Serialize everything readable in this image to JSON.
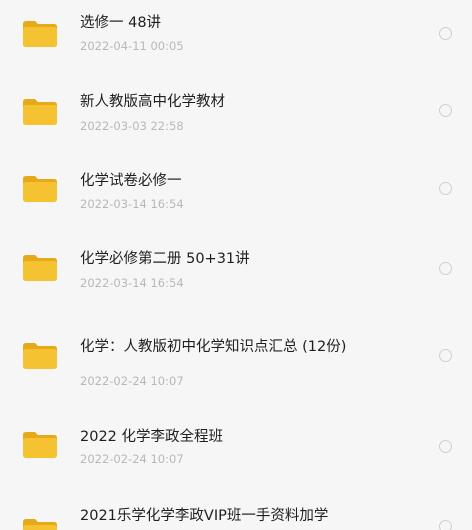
{
  "files": [
    {
      "name": "选修一 48讲",
      "date": "2022-04-11 00:05",
      "selected": false,
      "icon": "folder-icon"
    },
    {
      "name": "新人教版高中化学教材",
      "date": "2022-03-03 22:58",
      "selected": false,
      "icon": "folder-icon"
    },
    {
      "name": "化学试卷必修一",
      "date": "2022-03-14 16:54",
      "selected": false,
      "icon": "folder-icon"
    },
    {
      "name": "化学必修第二册 50+31讲",
      "date": "2022-03-14 16:54",
      "selected": false,
      "icon": "folder-icon"
    },
    {
      "name": "化学：人教版初中化学知识点汇总 (12份)",
      "date": "2022-02-24 10:07",
      "selected": false,
      "icon": "folder-icon"
    },
    {
      "name": "2022 化学李政全程班",
      "date": "2022-02-24 10:07",
      "selected": false,
      "icon": "folder-icon"
    },
    {
      "name": "2021乐学化学李政VIP班一手资料加学",
      "date": "",
      "selected": false,
      "icon": "folder-icon"
    }
  ],
  "colors": {
    "background": "#f6f6f6",
    "folder_body": "#f5c231",
    "folder_back": "#e6a91a",
    "name_text": "#1f1f1f",
    "date_text": "#b8b8b8",
    "radio_border": "#cfcfcf"
  }
}
